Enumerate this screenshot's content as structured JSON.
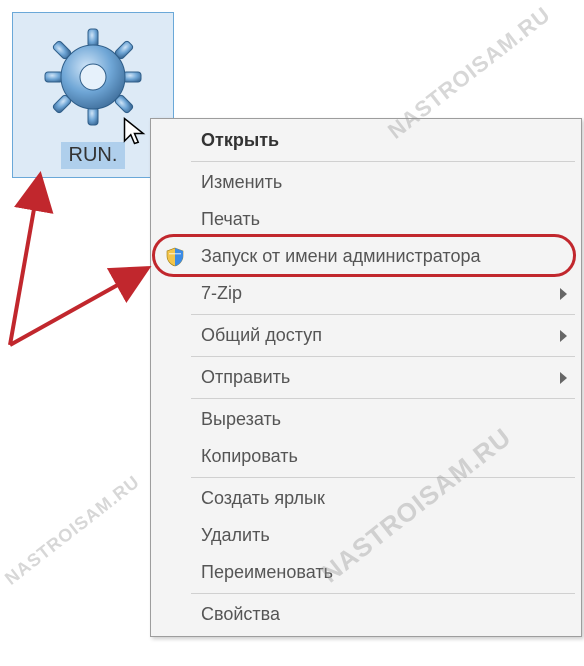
{
  "desktop": {
    "icon_label": "RUN.",
    "icon_name": "gear-settings-icon"
  },
  "context_menu": {
    "items": [
      {
        "label": "Открыть",
        "bold": true,
        "submenu": false,
        "icon": null
      },
      {
        "sep": true
      },
      {
        "label": "Изменить",
        "bold": false,
        "submenu": false,
        "icon": null
      },
      {
        "label": "Печать",
        "bold": false,
        "submenu": false,
        "icon": null
      },
      {
        "label": "Запуск от имени администратора",
        "bold": false,
        "submenu": false,
        "icon": "shield-icon"
      },
      {
        "label": "7-Zip",
        "bold": false,
        "submenu": true,
        "icon": null
      },
      {
        "sep": true
      },
      {
        "label": "Общий доступ",
        "bold": false,
        "submenu": true,
        "icon": null
      },
      {
        "sep": true
      },
      {
        "label": "Отправить",
        "bold": false,
        "submenu": true,
        "icon": null
      },
      {
        "sep": true
      },
      {
        "label": "Вырезать",
        "bold": false,
        "submenu": false,
        "icon": null
      },
      {
        "label": "Копировать",
        "bold": false,
        "submenu": false,
        "icon": null
      },
      {
        "sep": true
      },
      {
        "label": "Создать ярлык",
        "bold": false,
        "submenu": false,
        "icon": null
      },
      {
        "label": "Удалить",
        "bold": false,
        "submenu": false,
        "icon": null
      },
      {
        "label": "Переименовать",
        "bold": false,
        "submenu": false,
        "icon": null
      },
      {
        "sep": true
      },
      {
        "label": "Свойства",
        "bold": false,
        "submenu": false,
        "icon": null
      }
    ]
  },
  "watermark_text": "NASTROISAM.RU",
  "annotations": {
    "highlight_item_index": 4
  }
}
